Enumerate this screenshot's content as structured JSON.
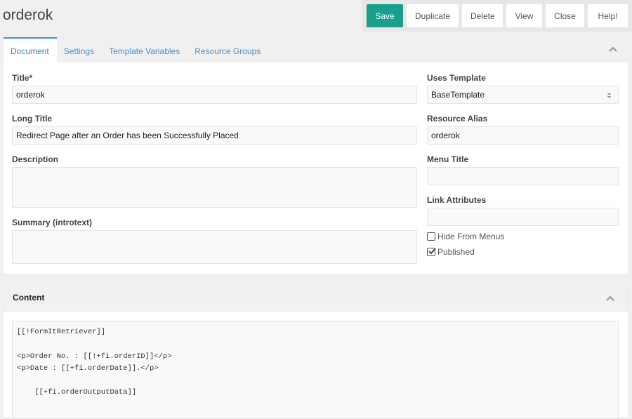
{
  "page": {
    "title": "orderok"
  },
  "toolbar": {
    "save_label": "Save",
    "duplicate_label": "Duplicate",
    "delete_label": "Delete",
    "view_label": "View",
    "close_label": "Close",
    "help_label": "Help!"
  },
  "tabs": [
    {
      "label": "Document",
      "active": true
    },
    {
      "label": "Settings",
      "active": false
    },
    {
      "label": "Template Variables",
      "active": false
    },
    {
      "label": "Resource Groups",
      "active": false
    }
  ],
  "document": {
    "title": {
      "label": "Title*",
      "value": "orderok"
    },
    "long_title": {
      "label": "Long Title",
      "value": "Redirect Page after an Order has been Successfully Placed"
    },
    "description": {
      "label": "Description",
      "value": ""
    },
    "summary": {
      "label": "Summary (introtext)",
      "value": ""
    },
    "uses_template": {
      "label": "Uses Template",
      "value": "BaseTemplate"
    },
    "resource_alias": {
      "label": "Resource Alias",
      "value": "orderok"
    },
    "menu_title": {
      "label": "Menu Title",
      "value": ""
    },
    "link_attributes": {
      "label": "Link Attributes",
      "value": ""
    },
    "hide_from_menus": {
      "label": "Hide From Menus",
      "checked": false
    },
    "published": {
      "label": "Published",
      "checked": true
    }
  },
  "content": {
    "title": "Content",
    "code": "[[!FormItRetriever]]\n\n<p>Order No. : [[!+fi.orderID]]</p>\n<p>Date : [[+fi.orderDate]].</p>\n\n    [[+fi.orderOutputData]]"
  },
  "colors": {
    "accent": "#1a9e8d",
    "tab_link": "#4a90c8",
    "tab_active_border": "#3697cd"
  }
}
